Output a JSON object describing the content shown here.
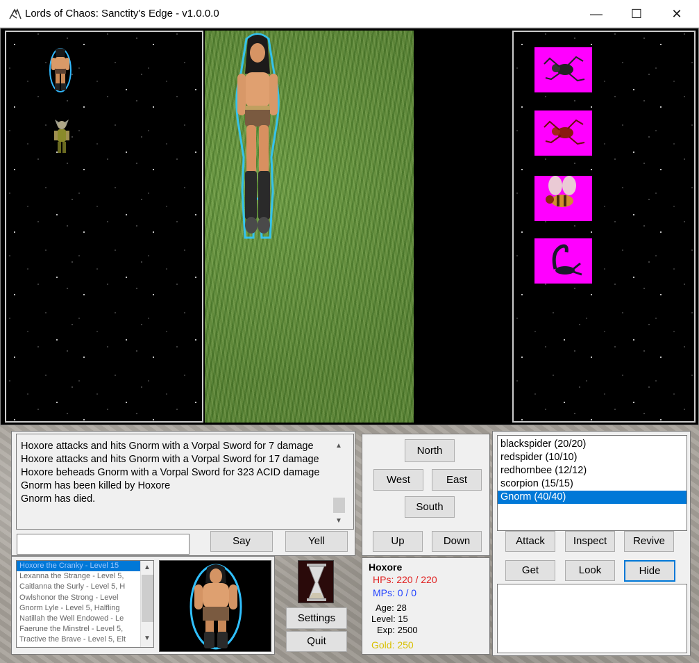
{
  "window": {
    "title": "Lords of Chaos: Sanctity's Edge - v1.0.0.0",
    "minimize_glyph": "—",
    "maximize_glyph": "☐",
    "close_glyph": "✕"
  },
  "game": {
    "left_pane_units": [
      "barbarian-icon",
      "goblin-icon"
    ],
    "center_unit": "barbarian-icon",
    "monsters": [
      "blackspider-icon",
      "redspider-icon",
      "redhornbee-icon",
      "scorpion-icon"
    ],
    "colors": {
      "monster_tile": "#ff00ff",
      "selection": "#0078d7",
      "hp_red": "#e02020",
      "mp_blue": "#2040ff",
      "gold": "#d8c000"
    }
  },
  "chat": {
    "lines": [
      "Hoxore attacks and hits Gnorm with a Vorpal Sword for 7 damage",
      "Hoxore attacks and hits Gnorm with a Vorpal Sword for 17 damage",
      "Hoxore beheads Gnorm with a Vorpal Sword for 323 ACID damage",
      "Gnorm has been killed by Hoxore",
      "Gnorm has died."
    ],
    "input_value": "",
    "say_label": "Say",
    "yell_label": "Yell"
  },
  "movement": {
    "north": "North",
    "west": "West",
    "east": "East",
    "south": "South",
    "up": "Up",
    "down": "Down"
  },
  "players": {
    "items": [
      "Hoxore the Cranky -  Level 15",
      "Lexanna the Strange -  Level 5,",
      "Caitlanna the Surly -  Level 5, H",
      "Owlshonor the Strong -  Level",
      "Gnorm Lyle -  Level 5, Halfling",
      "Natillah the Well Endowed -  Le",
      "Faerune the Minstrel -  Level 5,",
      "Tractive the Brave -  Level 5, Elt"
    ],
    "selected_index": 0
  },
  "controls": {
    "settings_label": "Settings",
    "quit_label": "Quit"
  },
  "character": {
    "name": "Hoxore",
    "hp_label": "HPs: 220 / 220",
    "mp_label": "MPs: 0 / 0",
    "age_label": "Age: 28",
    "level_label": "Level: 15",
    "exp_label": "Exp: 2500",
    "gold_label": "Gold: 250"
  },
  "targets": {
    "items": [
      "blackspider (20/20)",
      "redspider (10/10)",
      "redhornbee (12/12)",
      "scorpion (15/15)",
      "Gnorm (40/40)"
    ],
    "selected_index": 4
  },
  "actions": {
    "attack": "Attack",
    "inspect": "Inspect",
    "revive": "Revive",
    "get": "Get",
    "look": "Look",
    "hide": "Hide"
  }
}
